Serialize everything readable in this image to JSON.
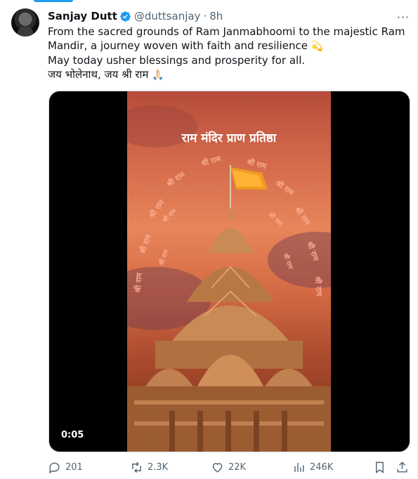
{
  "tweet": {
    "author_name": "Sanjay Dutt",
    "handle": "@duttsanjay",
    "separator": "·",
    "time": "8h",
    "more": "···",
    "text_line1": "From the sacred grounds of Ram Janmabhoomi to the majestic Ram",
    "text_line2": "Mandir, a journey woven with faith and resilience",
    "emoji1": "💫",
    "text_line3": "May today usher blessings and prosperity for all.",
    "text_line4": "जय भोलेनाथ, जय श्री राम",
    "emoji2": "🙏🏻"
  },
  "video": {
    "title": "राम मंदिर प्राण प्रतिष्ठा",
    "repeat_text": "श्री राम",
    "timestamp": "0:05"
  },
  "actions": {
    "replies": "201",
    "reposts": "2.3K",
    "likes": "22K",
    "views": "246K"
  },
  "colors": {
    "accent": "#1d9bf0",
    "secondary_text": "#536471",
    "sky_orange": "#e8855a",
    "temple": "#c98a55"
  }
}
